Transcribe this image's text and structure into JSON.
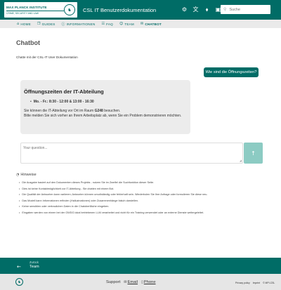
{
  "header": {
    "logo_title": "MAX PLANCK INSTITUTE",
    "logo_subtitle": "CRIME, SECURITY AND LAW",
    "site_title": "CSL IT Benutzerdokumentation",
    "icons": [
      "settings-icon",
      "translate-icon",
      "tag-icon",
      "lock-icon"
    ],
    "search_placeholder": "Suche"
  },
  "nav": {
    "items": [
      {
        "label": "HOME",
        "icon": "home-icon"
      },
      {
        "label": "GUIDES",
        "icon": "guides-icon"
      },
      {
        "label": "INFORMATIONEN",
        "icon": "info-icon"
      },
      {
        "label": "FAQ",
        "icon": "faq-icon"
      },
      {
        "label": "TEAM",
        "icon": "team-icon"
      },
      {
        "label": "CHATBOT",
        "icon": "chat-icon"
      }
    ]
  },
  "page": {
    "title": "Chatbot",
    "intro": "Chatte mit der CSL-IT User Dokumentation"
  },
  "chat": {
    "user_message": "Wie sind die Öffnungszeiten?",
    "answer_heading": "Öffnungszeiten der IT-Abteilung",
    "answer_hours": "Mo. - Fr.: 8:30 - 12:00 & 13:00 - 16:30",
    "answer_room_prefix": "Sie können die IT-Abteilung vor Ort im Raum ",
    "answer_room": "G248",
    "answer_room_suffix": " besuchen.",
    "answer_note": "Bitte melden Sie sich vorher an Ihrem Arbeitsplatz ab, wenn Sie ein Problem demonstrieren möchten.",
    "input_placeholder": "Your question..."
  },
  "hints": {
    "title": "Hinweise",
    "items": [
      "Die Ausgabe basiert auf den Dokumenten dieses Projekts - nutzen Sie im Zweifel die Suchfunktion dieser Seite.",
      "Dies ist keine Kontaktmöglichkeit zur IT-Abteilung - Sie chatten mit einem Bot.",
      "Die Qualität der Antworten kann variieren; Antworten können unvollständig oder fehlerhaft sein. Wiederholen Sie Ihre Anfrage oder formulieren Sie diese neu.",
      "Das Modell kann Informationen erfinden (Halluzinationen) oder Zusammenhänge falsch darstellen.",
      "Keine sensiblen oder vertraulichen Daten in die Chatoberfläche eingeben.",
      "Eingaben werden von einem bei der GWDG lokal betriebenen LLM verarbeitet und nicht für ein Training verwendet oder an externe Dienste weitergeleitet."
    ]
  },
  "footer": {
    "back_label": "Zurück",
    "back_title": "Team",
    "support_label": "Support",
    "email_label": "Email",
    "phone_label": "Phone",
    "privacy": "Privacy policy",
    "imprint": "Imprint",
    "copyright": "© MPI-CSL"
  },
  "colors": {
    "brand": "#006c66",
    "send_button": "#8ccbc3",
    "answer_bg": "#ececec"
  }
}
